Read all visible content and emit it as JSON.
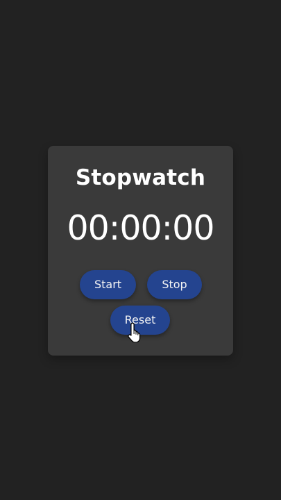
{
  "app": {
    "title": "Stopwatch",
    "time_display": "00:00:00"
  },
  "controls": {
    "start_label": "Start",
    "stop_label": "Stop",
    "reset_label": "Reset"
  },
  "cursor": {
    "icon": "hand-pointer-icon"
  },
  "colors": {
    "background": "#222222",
    "card": "#3a3a3a",
    "button": "#24448f",
    "text": "#ffffff"
  }
}
